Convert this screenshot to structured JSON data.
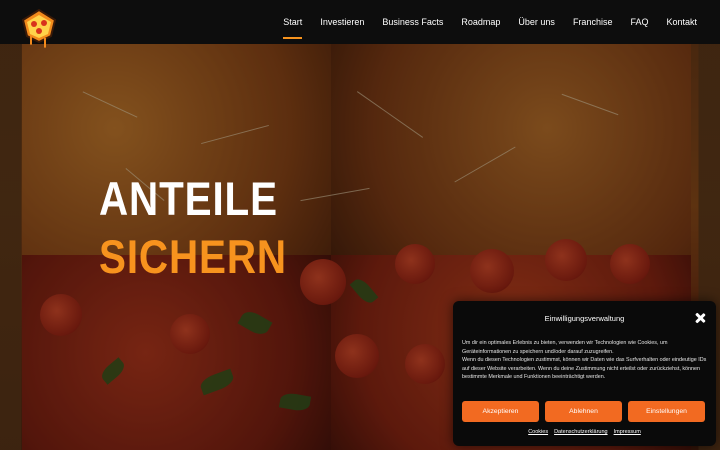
{
  "header": {
    "logo_icon": "pizza-slice-logo",
    "nav": [
      {
        "label": "Start",
        "active": true
      },
      {
        "label": "Investieren",
        "active": false
      },
      {
        "label": "Business Facts",
        "active": false
      },
      {
        "label": "Roadmap",
        "active": false
      },
      {
        "label": "Über uns",
        "active": false
      },
      {
        "label": "Franchise",
        "active": false
      },
      {
        "label": "FAQ",
        "active": false
      },
      {
        "label": "Kontakt",
        "active": false
      }
    ]
  },
  "hero": {
    "line1": "ANTEILE",
    "line2": "SICHERN",
    "accent_color": "#f7931e"
  },
  "consent": {
    "title": "Einwilligungsverwaltung",
    "close_icon": "close-icon",
    "text": [
      "Um dir ein optimales Erlebnis zu bieten, verwenden wir Technologien wie Cookies, um Geräteinformationen zu speichern und/oder darauf zuzugreifen.",
      "Wenn du diesen Technologien zustimmst, können wir Daten wie das Surfverhalten oder eindeutige IDs auf dieser Website verarbeiten. Wenn du deine Zustimmung nicht erteilst oder zurückziehst, können bestimmte Merkmale und Funktionen beeinträchtigt werden."
    ],
    "buttons": {
      "accept": "Akzeptieren",
      "decline": "Ablehnen",
      "settings": "Einstellungen"
    },
    "links": {
      "cookies": "Cookies",
      "privacy": "Datenschutzerklärung",
      "imprint": "Impressum"
    },
    "button_color": "#f26a21"
  }
}
